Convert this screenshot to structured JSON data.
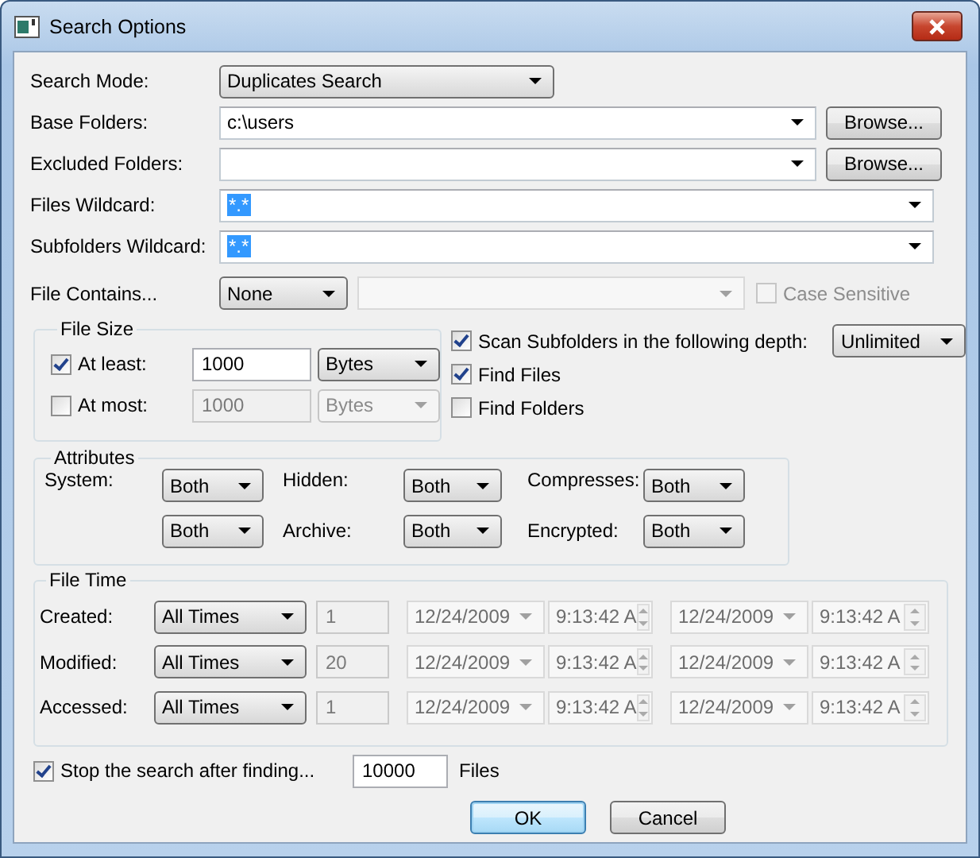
{
  "window": {
    "title": "Search Options"
  },
  "fields": [
    {
      "label": "Search Mode:",
      "kind": "dropdown",
      "value": "Duplicates Search"
    },
    {
      "label": "Base Folders:",
      "kind": "combo",
      "value": "c:\\users",
      "button": "Browse..."
    },
    {
      "label": "Excluded Folders:",
      "kind": "combo",
      "button": "Browse..."
    },
    {
      "label": "Files Wildcard:",
      "kind": "combo",
      "value": "*.*",
      "text_selected": true
    },
    {
      "label": "Subfolders Wildcard:",
      "kind": "combo",
      "value": "*.*",
      "text_selected": true
    }
  ],
  "file_contains": {
    "label": "File Contains...",
    "mode": "None",
    "case_sensitive": {
      "label": "Case Sensitive",
      "checked": false,
      "disabled": true
    }
  },
  "file_size": {
    "title": "File Size",
    "rows": [
      {
        "label": "At least:",
        "checked": true,
        "value": "1000",
        "unit": "Bytes"
      },
      {
        "label": "At most:",
        "checked": false,
        "value": "1000",
        "unit": "Bytes"
      }
    ]
  },
  "options": [
    {
      "label": "Scan Subfolders in the following depth:",
      "checked": true,
      "depth": "Unlimited"
    },
    {
      "label": "Find Files",
      "checked": true
    },
    {
      "label": "Find Folders",
      "checked": false
    }
  ],
  "attributes": {
    "title": "Attributes",
    "rows": [
      [
        {
          "label": "System:",
          "value": "Both"
        },
        {
          "label": "Hidden:",
          "value": "Both"
        },
        {
          "label": "Compresses:",
          "value": "Both"
        }
      ],
      [
        {
          "value": "Both"
        },
        {
          "label": "Archive:",
          "value": "Both"
        },
        {
          "label": "Encrypted:",
          "value": "Both"
        }
      ]
    ]
  },
  "file_time": {
    "title": "File Time",
    "rows": [
      {
        "label": "Created:",
        "range": "All Times",
        "count": "1",
        "from_date": "12/24/2009",
        "from_time": "9:13:42 A",
        "to_date": "12/24/2009",
        "to_time": "9:13:42 A"
      },
      {
        "label": "Modified:",
        "range": "All Times",
        "count": "20",
        "from_date": "12/24/2009",
        "from_time": "9:13:42 A",
        "to_date": "12/24/2009",
        "to_time": "9:13:42 A"
      },
      {
        "label": "Accessed:",
        "range": "All Times",
        "count": "1",
        "from_date": "12/24/2009",
        "from_time": "9:13:42 A",
        "to_date": "12/24/2009",
        "to_time": "9:13:42 A"
      }
    ]
  },
  "stop": {
    "label": "Stop the search after finding...",
    "checked": true,
    "value": "10000",
    "unit": "Files"
  },
  "buttons": [
    {
      "label": "OK",
      "default": true
    },
    {
      "label": "Cancel",
      "default": false
    }
  ]
}
